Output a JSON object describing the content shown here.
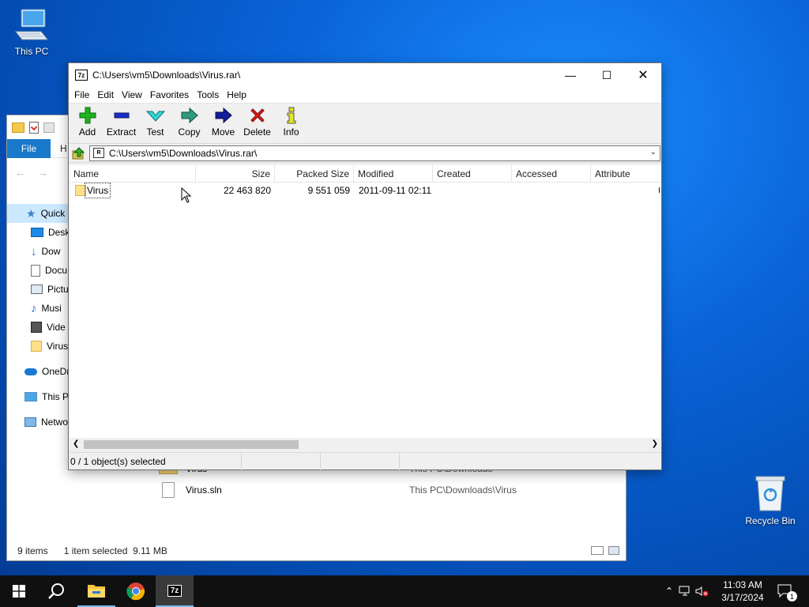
{
  "desktop": {
    "icons": [
      {
        "label": "This PC",
        "icon": "this-pc-icon"
      },
      {
        "label": "Recycle Bin",
        "icon": "recycle-bin-icon"
      }
    ]
  },
  "explorer": {
    "ribbon_tabs": {
      "file": "File",
      "home_partial": "H"
    },
    "sidebar": [
      {
        "label": "Quick",
        "icon": "star-icon"
      },
      {
        "label": "Desk",
        "icon": "desktop-icon"
      },
      {
        "label": "Dow",
        "icon": "download-icon"
      },
      {
        "label": "Docu",
        "icon": "documents-icon"
      },
      {
        "label": "Pictu",
        "icon": "pictures-icon"
      },
      {
        "label": "Musi",
        "icon": "music-icon"
      },
      {
        "label": "Vide",
        "icon": "videos-icon"
      },
      {
        "label": "Virus",
        "icon": "folder-icon"
      },
      {
        "label": "OneDr",
        "icon": "onedrive-icon"
      },
      {
        "label": "This P",
        "icon": "this-pc-icon"
      },
      {
        "label": "Netwo",
        "icon": "network-icon"
      }
    ],
    "rows": [
      {
        "name": "Virus",
        "location": "This PC\\Downloads"
      },
      {
        "name": "Virus.sln",
        "location": "This PC\\Downloads\\Virus"
      }
    ],
    "status": {
      "count": "9 items",
      "selected": "1 item selected  9.11 MB"
    }
  },
  "sevenzip": {
    "title": "C:\\Users\\vm5\\Downloads\\Virus.rar\\",
    "logo": "7z",
    "menu": [
      "File",
      "Edit",
      "View",
      "Favorites",
      "Tools",
      "Help"
    ],
    "toolbar": {
      "add": "Add",
      "extract": "Extract",
      "test": "Test",
      "copy": "Copy",
      "move": "Move",
      "delete": "Delete",
      "info": "Info"
    },
    "address": "C:\\Users\\vm5\\Downloads\\Virus.rar\\",
    "columns": {
      "name": "Name",
      "size": "Size",
      "packed": "Packed Size",
      "modified": "Modified",
      "created": "Created",
      "accessed": "Accessed",
      "attributes": "Attribute"
    },
    "files": [
      {
        "name": "Virus",
        "size": "22 463 820",
        "packed": "9 551 059",
        "modified": "2011-09-11 02:11",
        "created": "",
        "accessed": "",
        "attributes": "I"
      }
    ],
    "status": "0 / 1 object(s) selected"
  },
  "taskbar": {
    "clock_time": "11:03 AM",
    "clock_date": "3/17/2024",
    "notification_count": "1",
    "active_app": "7z"
  },
  "colors": {
    "accent": "#1979ca",
    "selection": "#cce8ff",
    "taskbar": "#101010"
  }
}
